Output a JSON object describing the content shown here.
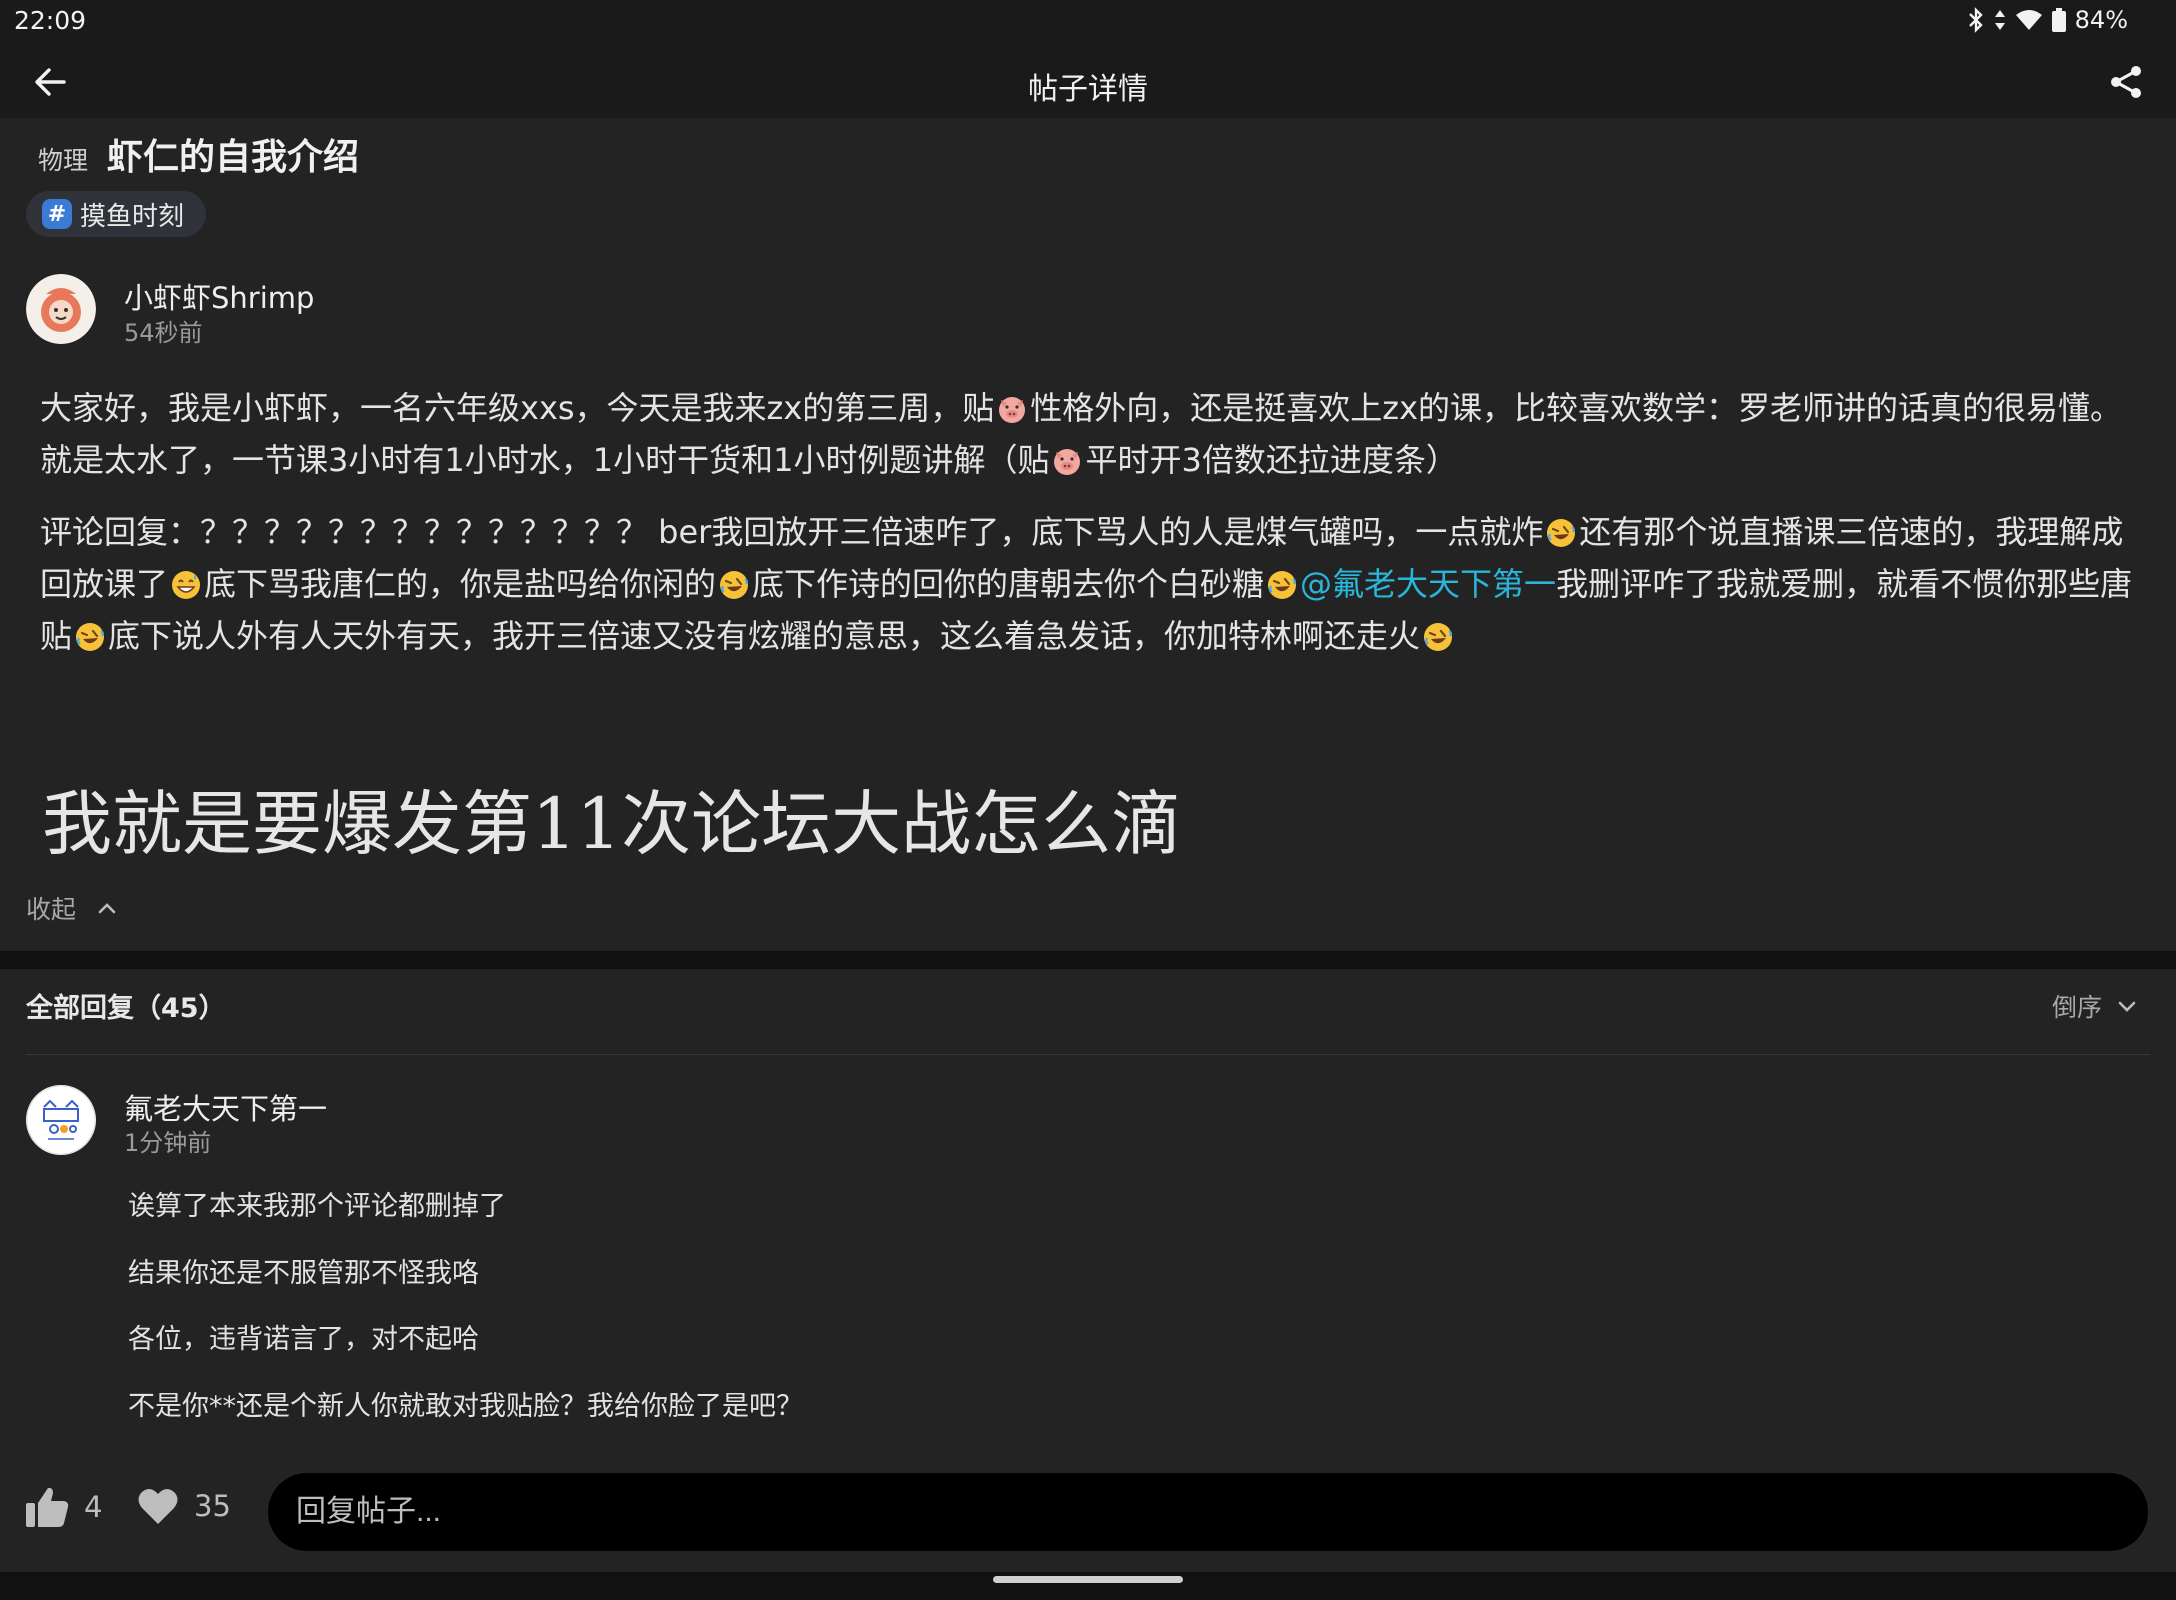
{
  "status_bar": {
    "time": "22:09",
    "battery": "84%"
  },
  "toolbar": {
    "title": "帖子详情",
    "back_icon": "arrow-left-icon",
    "share_icon": "share-icon"
  },
  "post": {
    "category": "物理",
    "title": "虾仁的自我介绍",
    "tag": "摸鱼时刻",
    "author": {
      "name": "小虾虾Shrimp",
      "time": "54秒前"
    },
    "para1": {
      "s1": "大家好，我是小虾虾，一名六年级xxs，今天是我来zx的第三周，贴",
      "s2": "性格外向，还是挺喜欢上zx的课，比较喜欢数学：罗老师讲的话真的很易懂。就是太水了，一节课3小时有1小时水，1小时干货和1小时例题讲解（贴",
      "s3": "平时开3倍数还拉进度条）"
    },
    "para2": {
      "s1": "评论回复：？？？？？？？？？？？？？？ ber我回放开三倍速咋了，底下骂人的人是煤气罐吗，一点就炸",
      "s2": "还有那个说直播课三倍速的，我理解成回放课了",
      "s3": "底下骂我唐仁的，你是盐吗给你闲的",
      "s4": "底下作诗的回你的唐朝去你个白砂糖",
      "mention": "@氟老大天下第一",
      "s5": "我删评咋了我就爱删，就看不惯你那些唐贴",
      "s6": "底下说人外有人天外有天，我开三倍速又没有炫耀的意思，这么着急发话，你加特林啊还走火"
    },
    "big_text": "我就是要爆发第11次论坛大战怎么滴",
    "collapse_label": "收起"
  },
  "replies": {
    "header": "全部回复（45）",
    "sort_label": "倒序",
    "items": [
      {
        "name": "氟老大天下第一",
        "time": "1分钟前",
        "lines": [
          "诶算了本来我那个评论都删掉了",
          "结果你还是不服管那不怪我咯",
          "各位，违背诺言了，对不起哈",
          "不是你**还是个新人你就敢对我贴脸？我给你脸了是吧？"
        ]
      }
    ]
  },
  "bottom_bar": {
    "like_count": "4",
    "fav_count": "35",
    "reply_placeholder": "回复帖子..."
  },
  "colors": {
    "background": "#232323",
    "toolbar": "#1a1a1a",
    "mention": "#29b6d9",
    "tag_hash": "#3a7bd5"
  }
}
